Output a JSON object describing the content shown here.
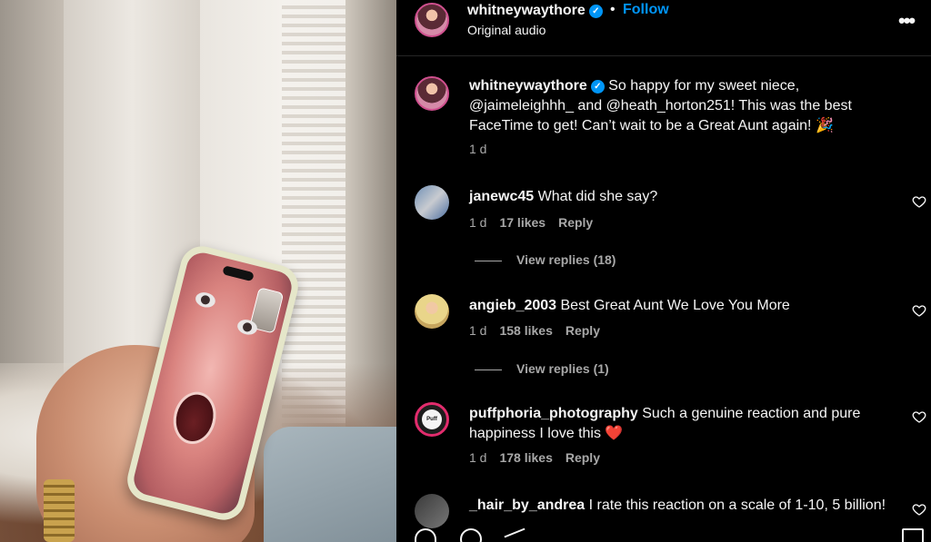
{
  "post": {
    "username": "whitneywaythore",
    "dot": "•",
    "follow_label": "Follow",
    "audio": "Original audio",
    "more_icon": "more-horizontal-icon"
  },
  "caption": {
    "username": "whitneywaythore",
    "text": " So happy for my sweet niece, @jaimeleighhh_ and @heath_horton251! This was the best FaceTime to get! Can’t wait to be a Great Aunt again! 🎉",
    "time": "1 d"
  },
  "comments": [
    {
      "username": "janewc45",
      "text": " What did she say?",
      "time": "1 d",
      "likes": "17 likes",
      "reply": "Reply",
      "view_replies": "View replies (18)"
    },
    {
      "username": "angieb_2003",
      "text": " Best Great Aunt We Love You More",
      "time": "1 d",
      "likes": "158 likes",
      "reply": "Reply",
      "view_replies": "View replies (1)"
    },
    {
      "username": "puffphoria_photography",
      "text": " Such a genuine reaction and pure happiness I love this ❤️",
      "time": "1 d",
      "likes": "178 likes",
      "reply": "Reply",
      "avatar_text": "Puff Phoria"
    },
    {
      "username": "_hair_by_andrea",
      "text": " I rate this reaction on a scale of 1-10, 5 billion!"
    }
  ],
  "colors": {
    "follow": "#0095f6",
    "verified": "#0095f6",
    "heart_red": "#ff3040",
    "background": "#000000"
  }
}
